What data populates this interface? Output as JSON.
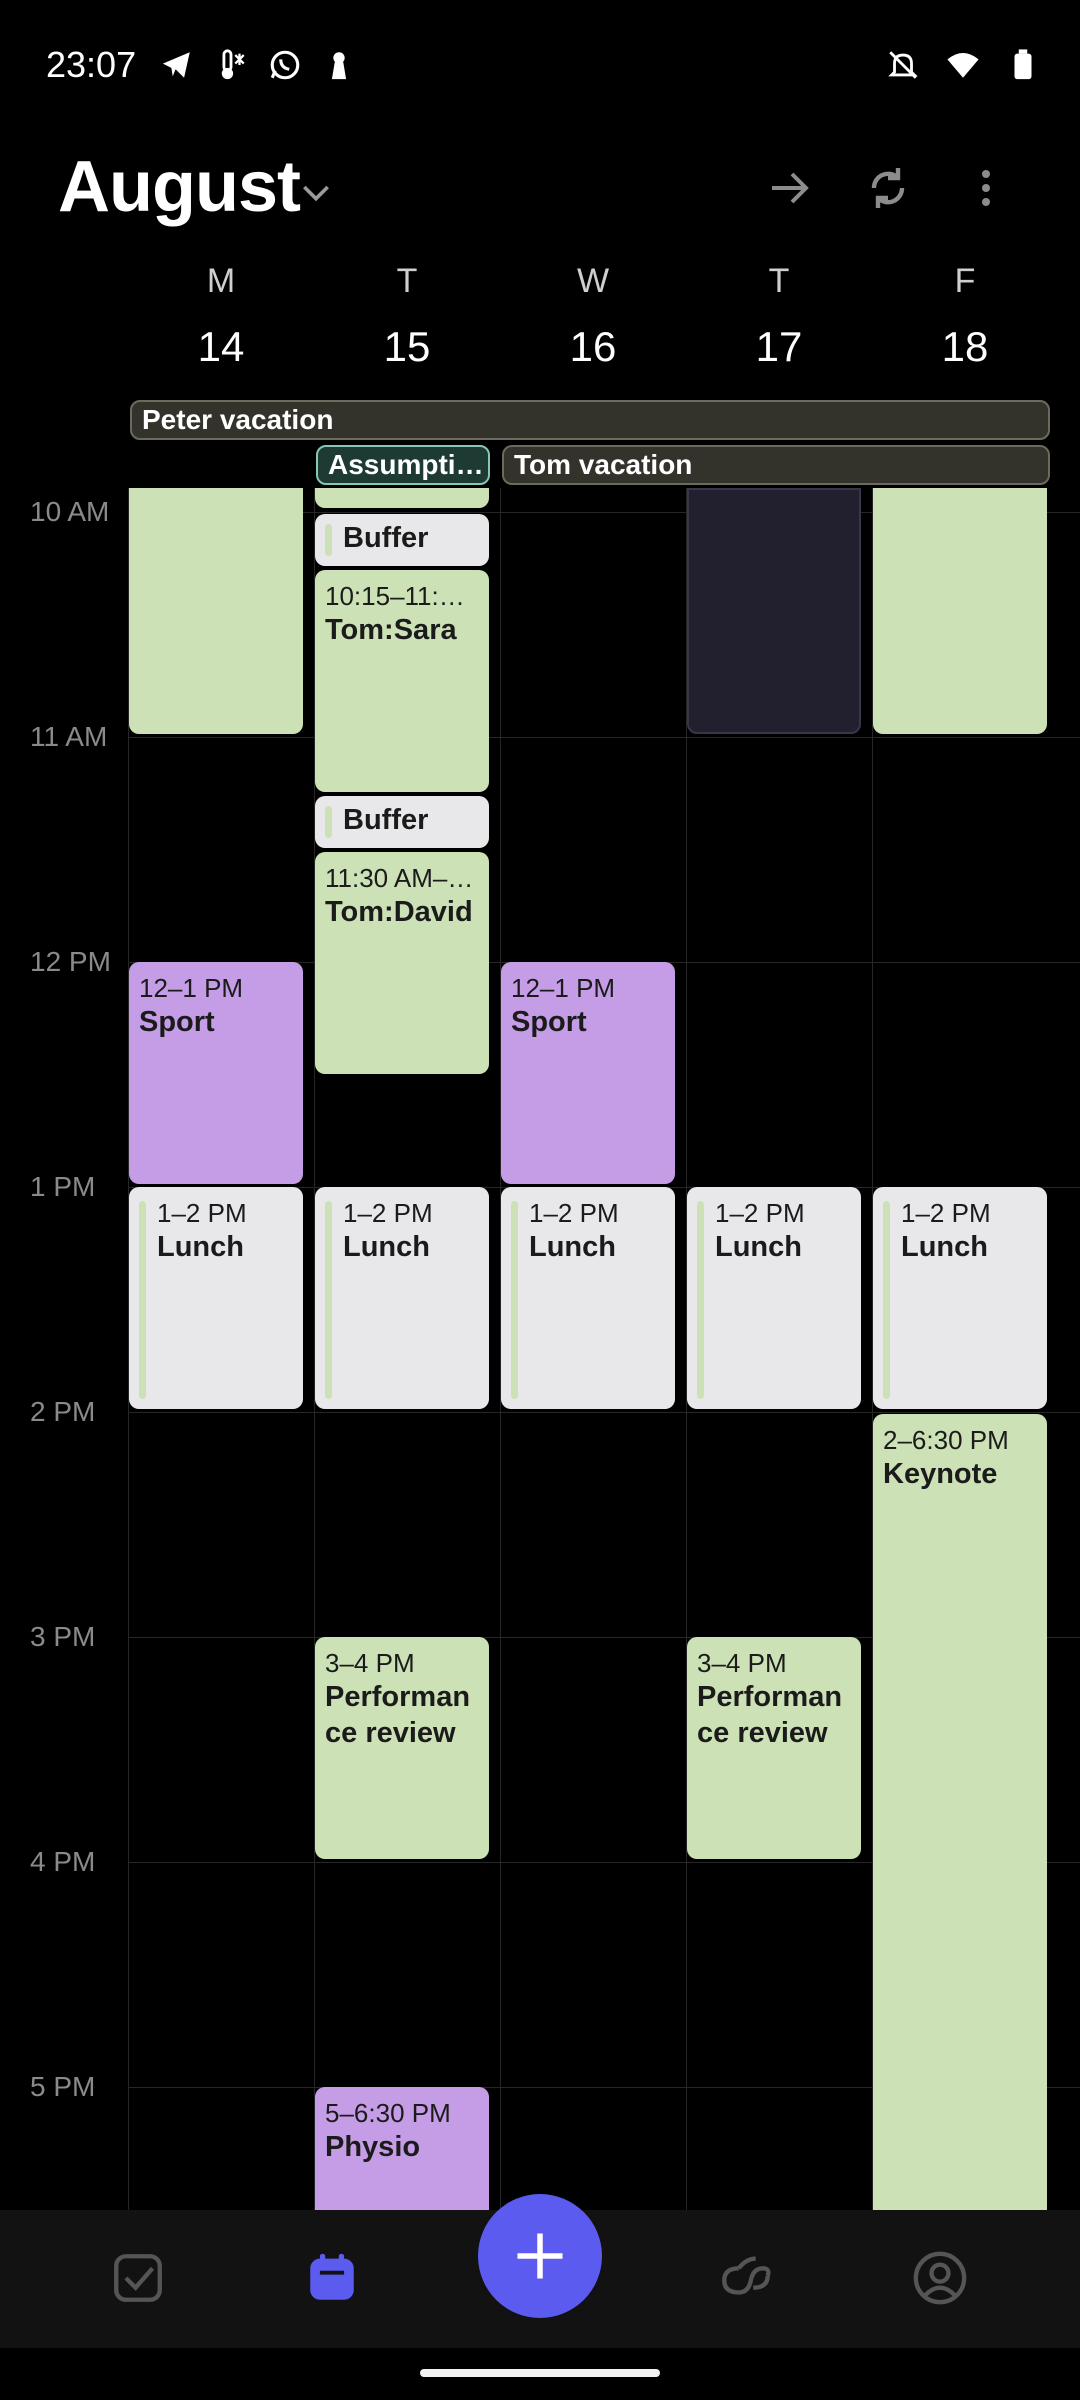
{
  "status_bar": {
    "time": "23:07"
  },
  "header": {
    "month": "August"
  },
  "days": [
    {
      "letter": "M",
      "number": "14"
    },
    {
      "letter": "T",
      "number": "15"
    },
    {
      "letter": "W",
      "number": "16"
    },
    {
      "letter": "T",
      "number": "17"
    },
    {
      "letter": "F",
      "number": "18"
    }
  ],
  "all_day_events": [
    {
      "title": "Peter vacation"
    },
    {
      "title": "Assumpti…"
    },
    {
      "title": "Tom vacation"
    }
  ],
  "hours": [
    "10 AM",
    "11 AM",
    "12 PM",
    "1 PM",
    "2 PM",
    "3 PM",
    "4 PM",
    "5 PM"
  ],
  "events": {
    "buffer1": {
      "title": "Buffer"
    },
    "tom_sara": {
      "time": "10:15–11:…",
      "title": "Tom:Sara"
    },
    "buffer2": {
      "title": "Buffer"
    },
    "tom_david": {
      "time": "11:30 AM–…",
      "title": "Tom:David"
    },
    "sport_mon": {
      "time": "12–1 PM",
      "title": "Sport"
    },
    "sport_wed": {
      "time": "12–1 PM",
      "title": "Sport"
    },
    "lunch": {
      "time": "1–2 PM",
      "title": "Lunch"
    },
    "keynote": {
      "time": "2–6:30 PM",
      "title": "Keynote"
    },
    "perf_tue": {
      "time": "3–4 PM",
      "title": "Performan ce review"
    },
    "perf_thu": {
      "time": "3–4 PM",
      "title": "Performan ce review"
    },
    "physio": {
      "time": "5–6:30 PM",
      "title": "Physio"
    }
  },
  "colors": {
    "event_green": "#cde1b6",
    "event_purple": "#c59ce6",
    "event_grey": "#e8e8ea",
    "fab": "#5b5bef"
  },
  "bottom_nav": [
    "tasks-icon",
    "calendar-icon",
    "add-icon",
    "links-icon",
    "profile-icon"
  ]
}
